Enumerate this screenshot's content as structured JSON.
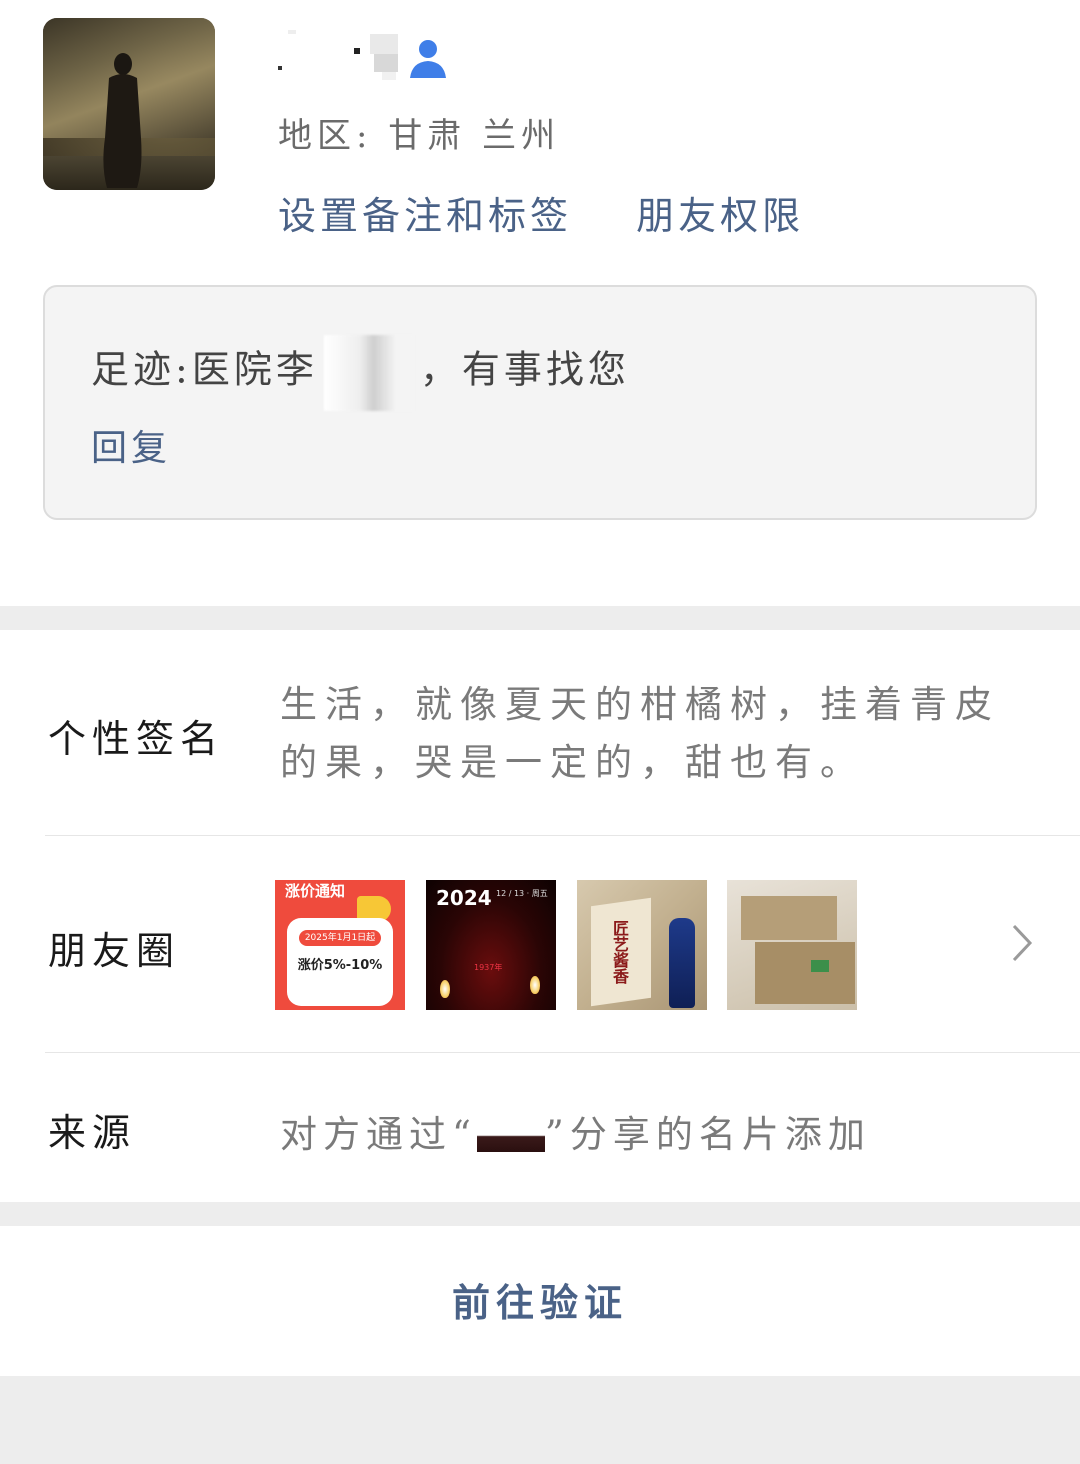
{
  "profile": {
    "region_label": "地区",
    "region_value": "甘肃  兰州",
    "links": {
      "remark_tag": "设置备注和标签",
      "permissions": "朋友权限"
    }
  },
  "footprint": {
    "prefix": "足迹:",
    "text_before": "医院李",
    "text_after": "，有事找您",
    "reply": "回复"
  },
  "signature": {
    "label": "个性签名",
    "text": "生活，就像夏天的柑橘树，挂着青皮的果，哭是一定的，甜也有。"
  },
  "moments": {
    "label": "朋友圈",
    "thumbs": [
      {
        "title": "涨价通知",
        "badge": "2025年1月1日起",
        "big": "涨价5%-10%"
      },
      {
        "year": "2024",
        "date": "12 / 13 · 周五",
        "red": "1937年"
      },
      {
        "label": "匠艺酱香"
      },
      {}
    ]
  },
  "source": {
    "label": "来源",
    "text_before": "对方通过“",
    "text_after": "”分享的名片添加"
  },
  "verify": {
    "label": "前往验证"
  },
  "colors": {
    "link": "#4a6287",
    "background_gap": "#ededed"
  },
  "icons": [
    "user-icon",
    "chevron-right-icon"
  ]
}
